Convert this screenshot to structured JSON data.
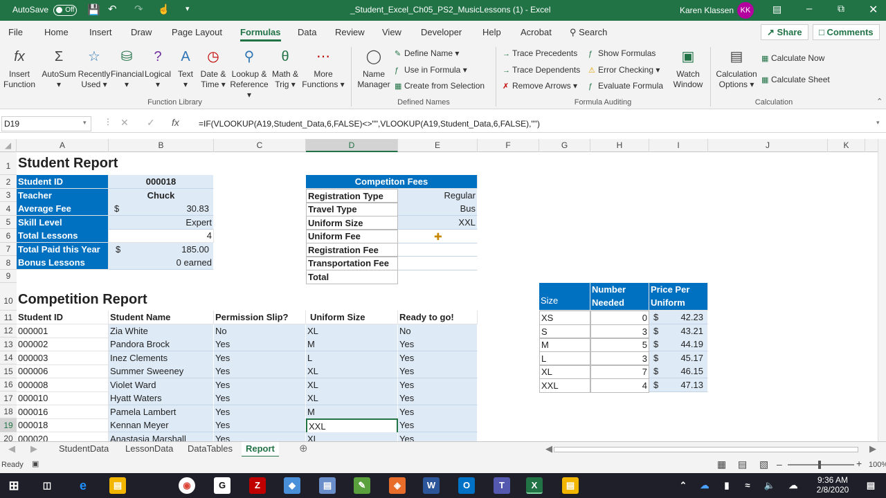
{
  "titlebar": {
    "autosave_label": "AutoSave",
    "autosave_state": "Off",
    "doc_title": "_Student_Excel_Ch05_PS2_MusicLessons (1)  -  Excel",
    "user_name": "Karen Klassen",
    "user_initials": "KK"
  },
  "menu": {
    "tabs": [
      "File",
      "Home",
      "Insert",
      "Draw",
      "Page Layout",
      "Formulas",
      "Data",
      "Review",
      "View",
      "Developer",
      "Help",
      "Acrobat"
    ],
    "search": "Search",
    "share": "Share",
    "comments": "Comments"
  },
  "ribbon": {
    "insert_function": [
      "Insert",
      "Function"
    ],
    "autosum": "AutoSum",
    "recently_used": [
      "Recently",
      "Used"
    ],
    "financial": "Financial",
    "logical": "Logical",
    "text": "Text",
    "date_time": [
      "Date &",
      "Time"
    ],
    "lookup": [
      "Lookup &",
      "Reference"
    ],
    "math": [
      "Math &",
      "Trig"
    ],
    "more": [
      "More",
      "Functions"
    ],
    "group_function_library": "Function Library",
    "name_manager": [
      "Name",
      "Manager"
    ],
    "define_name": "Define Name",
    "use_in_formula": "Use in Formula",
    "create_from_selection": "Create from Selection",
    "group_defined_names": "Defined Names",
    "trace_precedents": "Trace Precedents",
    "trace_dependents": "Trace Dependents",
    "remove_arrows": "Remove Arrows",
    "show_formulas": "Show Formulas",
    "error_checking": "Error Checking",
    "evaluate_formula": "Evaluate Formula",
    "watch_window": [
      "Watch",
      "Window"
    ],
    "group_formula_auditing": "Formula Auditing",
    "calc_options": [
      "Calculation",
      "Options"
    ],
    "calc_now": "Calculate Now",
    "calc_sheet": "Calculate Sheet",
    "group_calculation": "Calculation"
  },
  "formula_bar": {
    "name_box": "D19",
    "formula": "=IF(VLOOKUP(A19,Student_Data,6,FALSE)<>\"\",VLOOKUP(A19,Student_Data,6,FALSE),\"\")"
  },
  "columns": [
    "A",
    "B",
    "C",
    "D",
    "E",
    "F",
    "G",
    "H",
    "I",
    "J",
    "K"
  ],
  "rows": [
    "1",
    "2",
    "3",
    "4",
    "5",
    "6",
    "7",
    "8",
    "9",
    "10",
    "11",
    "12",
    "13",
    "14",
    "15",
    "16",
    "17",
    "18",
    "19",
    "20"
  ],
  "student_report": {
    "title": "Student Report",
    "labels": [
      "Student ID",
      "Teacher",
      "Average Fee",
      "Skill Level",
      "Total Lessons",
      "Total Paid this Year",
      "Bonus Lessons"
    ],
    "student_id": "000018",
    "teacher": "Chuck",
    "avg_fee_sym": "$",
    "avg_fee": "30.83",
    "skill": "Expert",
    "lessons": "4",
    "paid_sym": "$",
    "paid": "185.00",
    "bonus": "0 earned"
  },
  "fees": {
    "title": "Competiton Fees",
    "labels": [
      "Registration Type",
      "Travel Type",
      "Uniform Size",
      "Uniform Fee",
      "Registration Fee",
      "Transportation Fee",
      "Total"
    ],
    "reg_type": "Regular",
    "travel": "Bus",
    "size": "XXL"
  },
  "competition": {
    "title": "Competition Report",
    "headers": [
      "Student ID",
      "Student Name",
      "Permission Slip?",
      "Uniform Size",
      "Ready to go!"
    ],
    "rows": [
      [
        "000001",
        "Zia White",
        "No",
        "XL",
        "No"
      ],
      [
        "000002",
        "Pandora Brock",
        "Yes",
        "M",
        "Yes"
      ],
      [
        "000003",
        "Inez Clements",
        "Yes",
        "L",
        "Yes"
      ],
      [
        "000006",
        "Summer Sweeney",
        "Yes",
        "XL",
        "Yes"
      ],
      [
        "000008",
        "Violet Ward",
        "Yes",
        "XL",
        "Yes"
      ],
      [
        "000010",
        "Hyatt Waters",
        "Yes",
        "XL",
        "Yes"
      ],
      [
        "000016",
        "Pamela Lambert",
        "Yes",
        "M",
        "Yes"
      ],
      [
        "000018",
        "Kennan Meyer",
        "Yes",
        "XXL",
        "Yes"
      ],
      [
        "000020",
        "Anastasia Marshall",
        "Yes",
        "XL",
        "Yes"
      ]
    ]
  },
  "uniforms": {
    "headers": [
      "Size",
      "Number\nNeeded",
      "Price Per\nUniform"
    ],
    "h_size": "Size",
    "h_needed_1": "Number",
    "h_needed_2": "Needed",
    "h_price_1": "Price Per",
    "h_price_2": "Uniform",
    "rows": [
      [
        "XS",
        "0",
        "$",
        "42.23"
      ],
      [
        "S",
        "3",
        "$",
        "43.21"
      ],
      [
        "M",
        "5",
        "$",
        "44.19"
      ],
      [
        "L",
        "3",
        "$",
        "45.17"
      ],
      [
        "XL",
        "7",
        "$",
        "46.15"
      ],
      [
        "XXL",
        "4",
        "$",
        "47.13"
      ]
    ]
  },
  "sheet_tabs": [
    "StudentData",
    "LessonData",
    "DataTables",
    "Report"
  ],
  "status": {
    "ready": "Ready",
    "zoom": "100%"
  },
  "clock": {
    "time": "9:36 AM",
    "date": "2/8/2020"
  }
}
